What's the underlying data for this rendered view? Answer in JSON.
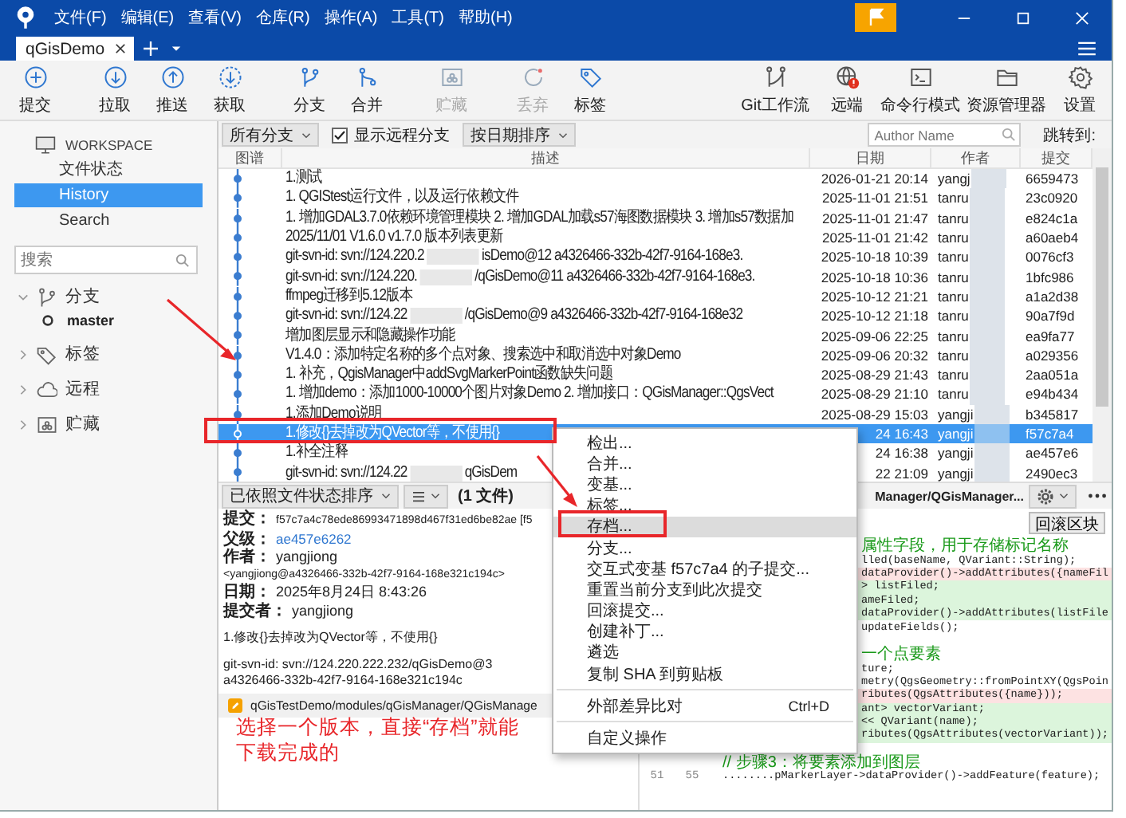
{
  "window": {
    "menu": [
      "文件(F)",
      "编辑(E)",
      "查看(V)",
      "仓库(R)",
      "操作(A)",
      "工具(T)",
      "帮助(H)"
    ]
  },
  "tabs": [
    {
      "label": "qGisDemo",
      "selected": true
    }
  ],
  "toolbar": {
    "left": [
      {
        "label": "提交",
        "disabled": false
      },
      {
        "label": "拉取",
        "disabled": false
      },
      {
        "label": "推送",
        "disabled": false
      },
      {
        "label": "获取",
        "disabled": false
      },
      {
        "label": "分支",
        "disabled": false
      },
      {
        "label": "合并",
        "disabled": false
      },
      {
        "label": "贮藏",
        "disabled": true
      },
      {
        "label": "丢弃",
        "disabled": true
      },
      {
        "label": "标签",
        "disabled": false
      }
    ],
    "right": [
      {
        "label": "Git工作流"
      },
      {
        "label": "远端"
      },
      {
        "label": "命令行模式"
      },
      {
        "label": "资源管理器"
      },
      {
        "label": "设置"
      }
    ]
  },
  "sidebar": {
    "workspace": "WORKSPACE",
    "items": [
      {
        "label": "文件状态",
        "selected": false
      },
      {
        "label": "History",
        "selected": true
      },
      {
        "label": "Search",
        "selected": false
      }
    ],
    "search": {
      "placeholder": "搜索"
    },
    "tree": [
      {
        "label": "分支",
        "expanded": true,
        "children": [
          {
            "label": "master",
            "current": true
          }
        ]
      },
      {
        "label": "标签",
        "expanded": false
      },
      {
        "label": "远程",
        "expanded": false
      },
      {
        "label": "贮藏",
        "expanded": false
      }
    ]
  },
  "filters": {
    "branch": "所有分支",
    "show_remote": {
      "label": "显示远程分支",
      "checked": true
    },
    "sort": "按日期排序",
    "author": {
      "placeholder": "Author Name"
    },
    "jump": "跳转到:"
  },
  "table": {
    "columns": [
      "图谱",
      "描述",
      "日期",
      "作者",
      "提交"
    ],
    "rows": [
      {
        "selected": false,
        "desc": "1.测试",
        "date": "2026-01-21 20:14",
        "author": "yangj",
        "commit": "6659473"
      },
      {
        "selected": false,
        "desc": "1. QGIStest运行文件，以及运行依赖文件",
        "date": "2025-11-01 21:51",
        "author": "tanru",
        "commit": "23c0920"
      },
      {
        "selected": false,
        "desc": "1. 增加GDAL3.7.0依赖环境管理模块 2. 增加GDAL加载s57海图数据模块 3. 增加s57数据加",
        "date": "2025-11-01 21:47",
        "author": "tanru",
        "commit": "e824c1a"
      },
      {
        "selected": false,
        "desc": "2025/11/01 V1.6.0 v1.7.0 版本列表更新",
        "date": "2025-11-01 21:42",
        "author": "tanru",
        "commit": "a60aeb4"
      },
      {
        "selected": false,
        "desc": "git-svn-id: svn://124.220.2",
        "tail": "isDemo@12 a4326466-332b-42f7-9164-168e3.",
        "date": "2025-10-18 10:39",
        "author": "tanru",
        "commit": "0076cf3"
      },
      {
        "selected": false,
        "desc": "git-svn-id: svn://124.220.",
        "tail": "/qGisDemo@11 a4326466-332b-42f7-9164-168e3.",
        "date": "2025-10-18 10:36",
        "author": "tanru",
        "commit": "1bfc986"
      },
      {
        "selected": false,
        "desc": "ffmpeg迁移到5.12版本",
        "date": "2025-10-12 21:21",
        "author": "tanru",
        "commit": "a1a2d38"
      },
      {
        "selected": false,
        "desc": "git-svn-id: svn://124.22",
        "tail": "/qGisDemo@9 a4326466-332b-42f7-9164-168e32",
        "date": "2025-10-12 21:18",
        "author": "tanru",
        "commit": "90a7f9d"
      },
      {
        "selected": false,
        "desc": "增加图层显示和隐藏操作功能",
        "date": "2025-09-06 22:25",
        "author": "tanru",
        "commit": "ea9fa77"
      },
      {
        "selected": false,
        "desc": "V1.4.0：添加特定名称的多个点对象、搜索选中和取消选中对象Demo",
        "date": "2025-09-06 20:32",
        "author": "tanru",
        "commit": "a029356"
      },
      {
        "selected": false,
        "desc": "1. 补充，QgisManager中addSvgMarkerPoint函数缺失问题",
        "date": "2025-08-29 21:43",
        "author": "tanru",
        "commit": "2aa051a"
      },
      {
        "selected": false,
        "desc": "1. 增加demo：添加1000-10000个图片对象Demo 2. 增加接口：QGisManager::QgsVect",
        "date": "2025-08-29 21:10",
        "author": "tanru",
        "commit": "e94b434"
      },
      {
        "selected": false,
        "desc": "1.添加Demo说明",
        "date": "2025-08-29 15:03",
        "author": "yangji",
        "commit": "b345817"
      },
      {
        "selected": true,
        "desc": "1.修改{}去掉改为QVector等，不使用{}",
        "date": "24 16:43",
        "author": "yangji",
        "commit": "f57c7a4"
      },
      {
        "selected": false,
        "desc": "1.补全注释",
        "date": "24 16:38",
        "author": "yangji",
        "commit": "ae457e6"
      },
      {
        "selected": false,
        "desc": "git-svn-id: svn://124.22",
        "tail": "qGisDem",
        "date": "22 21:09",
        "author": "yangji",
        "commit": "2490ec3"
      }
    ]
  },
  "files_bar": {
    "sort": "已依照文件状态排序",
    "count": "(1 文件)",
    "path": "Manager/QGisManager..."
  },
  "details": {
    "fields": [
      {
        "label": "提交：",
        "value": "f57c7a4c78ede86993471898d467f31ed6be82ae [f5",
        "kind": "id"
      },
      {
        "label": "父级：",
        "value": "ae457e6262",
        "kind": "link"
      },
      {
        "label": "作者：",
        "value": "yangjiong",
        "kind": "text"
      },
      {
        "value": "<yangjiong@a4326466-332b-42f7-9164-168e321c194c>",
        "kind": "id"
      },
      {
        "label": "日期：",
        "value": "2025年8月24日 8:43:26",
        "kind": "text"
      },
      {
        "label": "提交者：",
        "value": "yangjiong",
        "kind": "text"
      }
    ],
    "message": [
      [
        "1.修改{}去掉改为QVector等，不使用{}"
      ],
      [
        "git-svn-id: svn://124.220.222.232/qGisDemo@3",
        "a4326466-332b-42f7-9164-168e321c194c"
      ]
    ],
    "file": "qGisTestDemo/modules/qGisManager/QGisManage"
  },
  "diff": {
    "revert": "回滚区块",
    "lines": [
      {
        "kind": "comment",
        "clipped": true,
        "text": "属性字段，用于存储标记名称"
      },
      {
        "kind": "context",
        "clipped": true,
        "text": "lled(baseName, QVariant::String);"
      },
      {
        "kind": "removed",
        "clipped": true,
        "text": "dataProvider()->addAttributes({nameFil"
      },
      {
        "kind": "added",
        "clipped": true,
        "text": "> listFiled;"
      },
      {
        "kind": "added",
        "clipped": true,
        "text": "ameFiled;"
      },
      {
        "kind": "added",
        "clipped": true,
        "text": "dataProvider()->addAttributes(listFile"
      },
      {
        "kind": "context",
        "clipped": true,
        "text": "updateFields();"
      },
      {
        "kind": "spacer"
      },
      {
        "kind": "comment",
        "clipped": true,
        "text": "一个点要素"
      },
      {
        "kind": "context",
        "clipped": true,
        "text": "ture;"
      },
      {
        "kind": "context",
        "clipped": true,
        "text": "metry(QgsGeometry::fromPointXY(QgsPoin"
      },
      {
        "kind": "removed",
        "clipped": true,
        "text": "ributes(QgsAttributes({name}));"
      },
      {
        "kind": "added",
        "clipped": true,
        "text": "ant> vectorVariant;"
      },
      {
        "kind": "added",
        "clipped": true,
        "text": "<< QVariant(name);"
      },
      {
        "kind": "added",
        "clipped": true,
        "text": "ributes(QgsAttributes(vectorVariant));"
      },
      {
        "kind": "spacer"
      },
      {
        "kind": "comment",
        "clipped": false,
        "text": "// 步骤3：将要素添加到图层"
      },
      {
        "kind": "context",
        "clipped": false,
        "old": "51",
        "new": "55",
        "text": "........pMarkerLayer->dataProvider()->addFeature(feature);"
      }
    ]
  },
  "context_menu": [
    {
      "kind": "item",
      "label": "检出...",
      "highlighted": false
    },
    {
      "kind": "item",
      "label": "合并...",
      "highlighted": false
    },
    {
      "kind": "item",
      "label": "变基...",
      "highlighted": false
    },
    {
      "kind": "item",
      "label": "标签...",
      "highlighted": false
    },
    {
      "kind": "item",
      "label": "存档...",
      "highlighted": true
    },
    {
      "kind": "item",
      "label": "分支...",
      "highlighted": false
    },
    {
      "kind": "item",
      "label": "交互式变基 f57c7a4 的子提交...",
      "highlighted": false
    },
    {
      "kind": "item",
      "label": "重置当前分支到此次提交",
      "highlighted": false
    },
    {
      "kind": "item",
      "label": "回滚提交...",
      "highlighted": false
    },
    {
      "kind": "item",
      "label": "创建补丁...",
      "highlighted": false
    },
    {
      "kind": "item",
      "label": "遴选",
      "highlighted": false
    },
    {
      "kind": "item",
      "label": "复制 SHA 到剪贴板",
      "highlighted": false
    },
    {
      "kind": "separator"
    },
    {
      "kind": "item",
      "label": "外部差异比对",
      "shortcut": "Ctrl+D",
      "highlighted": false
    },
    {
      "kind": "separator"
    },
    {
      "kind": "item",
      "label": "自定义操作",
      "highlighted": false
    }
  ],
  "annotation": {
    "text": "选择一个版本，直接“存档”就能下载完成的"
  }
}
